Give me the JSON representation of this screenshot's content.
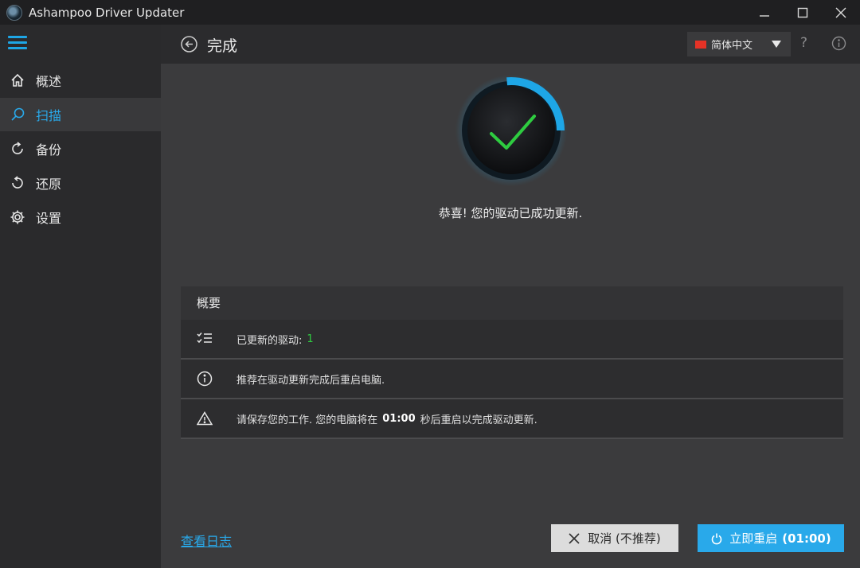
{
  "window": {
    "title": "Ashampoo Driver Updater"
  },
  "sidebar": {
    "menu_icon": "hamburger-icon",
    "items": [
      {
        "label": "概述",
        "icon": "home-icon",
        "active": false
      },
      {
        "label": "扫描",
        "icon": "search-icon",
        "active": true
      },
      {
        "label": "备份",
        "icon": "backup-icon",
        "active": false
      },
      {
        "label": "还原",
        "icon": "restore-icon",
        "active": false
      },
      {
        "label": "设置",
        "icon": "gear-icon",
        "active": false
      }
    ]
  },
  "header": {
    "title": "完成",
    "language": "简体中文",
    "help": "?"
  },
  "main": {
    "status_progress": 1.0,
    "congrats": "恭喜! 您的驱动已成功更新.",
    "summary": {
      "title": "概要",
      "updated_label": "已更新的驱动:",
      "updated_count": "1",
      "recommend": "推荐在驱动更新完成后重启电脑.",
      "warning_pre": "请保存您的工作. 您的电脑将在",
      "warning_time": "01:00",
      "warning_post": "秒后重启以完成驱动更新."
    },
    "log_link": "查看日志",
    "cancel_button": "取消 (不推荐)",
    "restart_button": "立即重启",
    "restart_time": "(01:00)"
  },
  "colors": {
    "accent": "#29a9ea",
    "success": "#2ecc40",
    "background": "#3b3b3d",
    "sidebar": "#2a2a2c"
  }
}
